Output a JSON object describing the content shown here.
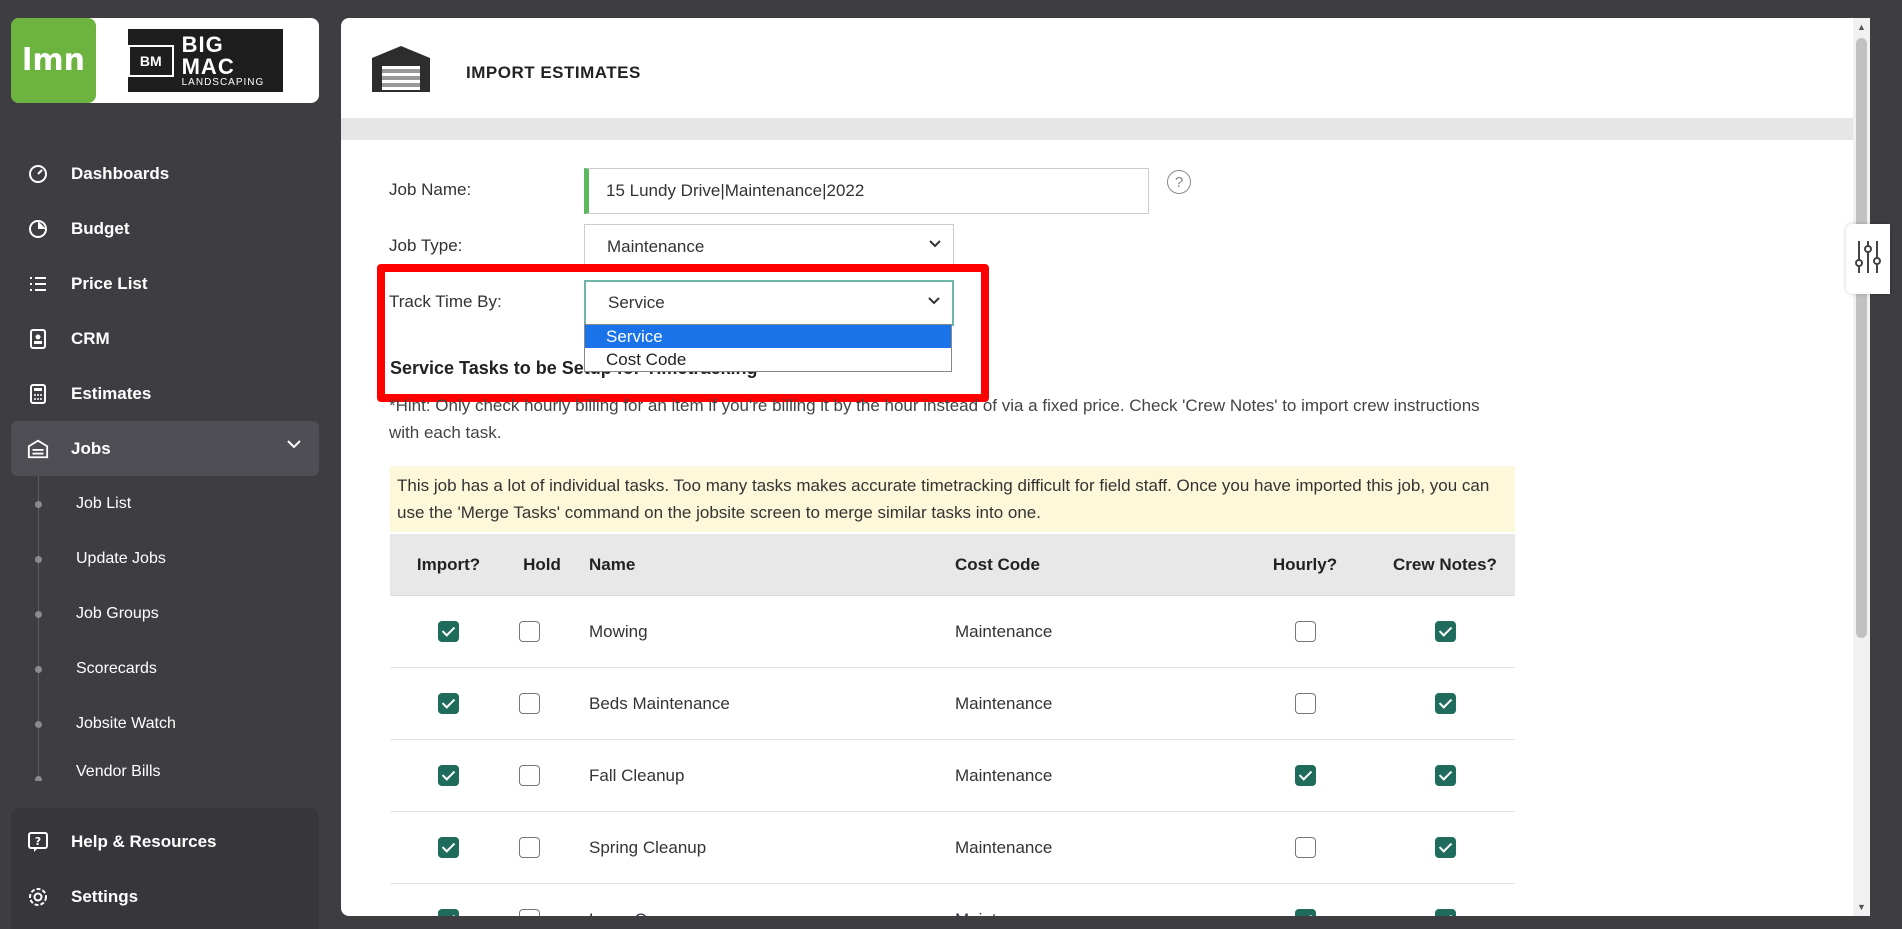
{
  "brand": {
    "lmn_logo": "lmn",
    "company_mark": "BM",
    "company_big": "BIG MAC",
    "company_small": "LANDSCAPING"
  },
  "sidebar": {
    "items": [
      {
        "label": "Dashboards",
        "icon": "dashboard-icon"
      },
      {
        "label": "Budget",
        "icon": "pie-chart-icon"
      },
      {
        "label": "Price List",
        "icon": "list-icon"
      },
      {
        "label": "CRM",
        "icon": "contact-icon"
      },
      {
        "label": "Estimates",
        "icon": "calculator-icon"
      },
      {
        "label": "Jobs",
        "icon": "jobs-icon"
      }
    ],
    "jobs_sub": [
      "Job List",
      "Update Jobs",
      "Job Groups",
      "Scorecards",
      "Jobsite Watch",
      "Vendor Bills"
    ],
    "bottom": [
      {
        "label": "Help & Resources",
        "icon": "help-icon"
      },
      {
        "label": "Settings",
        "icon": "gear-icon"
      }
    ]
  },
  "header": {
    "title": "IMPORT ESTIMATES"
  },
  "form": {
    "job_name_label": "Job Name:",
    "job_name_value": "15 Lundy Drive|Maintenance|2022",
    "job_type_label": "Job Type:",
    "job_type_value": "Maintenance",
    "track_label": "Track Time By:",
    "track_value": "Service",
    "track_options": [
      "Service",
      "Cost Code"
    ],
    "help": "?"
  },
  "section_title": "Service Tasks to be Setup for Timetracking",
  "hint": "*Hint: Only check hourly billing for an item if you're billing it by the hour instead of via a fixed price. Check 'Crew Notes' to import crew instructions with each task.",
  "warning": "This job has a lot of individual tasks. Too many tasks makes accurate timetracking difficult for field staff. Once you have imported this job, you can use the 'Merge Tasks' command on the jobsite screen to merge similar tasks into one.",
  "table": {
    "headers": [
      "Import?",
      "Hold",
      "Name",
      "Cost Code",
      "Hourly?",
      "Crew Notes?"
    ],
    "rows": [
      {
        "import": true,
        "hold": false,
        "name": "Mowing",
        "cost_code": "Maintenance",
        "hourly": false,
        "crew_notes": true
      },
      {
        "import": true,
        "hold": false,
        "name": "Beds Maintenance",
        "cost_code": "Maintenance",
        "hourly": false,
        "crew_notes": true
      },
      {
        "import": true,
        "hold": false,
        "name": "Fall Cleanup",
        "cost_code": "Maintenance",
        "hourly": true,
        "crew_notes": true
      },
      {
        "import": true,
        "hold": false,
        "name": "Spring Cleanup",
        "cost_code": "Maintenance",
        "hourly": false,
        "crew_notes": true
      },
      {
        "import": true,
        "hold": false,
        "name": "Lawn Care",
        "cost_code": "Maintenance",
        "hourly": true,
        "crew_notes": true
      }
    ]
  },
  "colors": {
    "accent_green": "#6cb33f",
    "checkbox_on": "#1f6b5c",
    "highlight_red": "#ff0000",
    "select_blue": "#1a73e8"
  }
}
